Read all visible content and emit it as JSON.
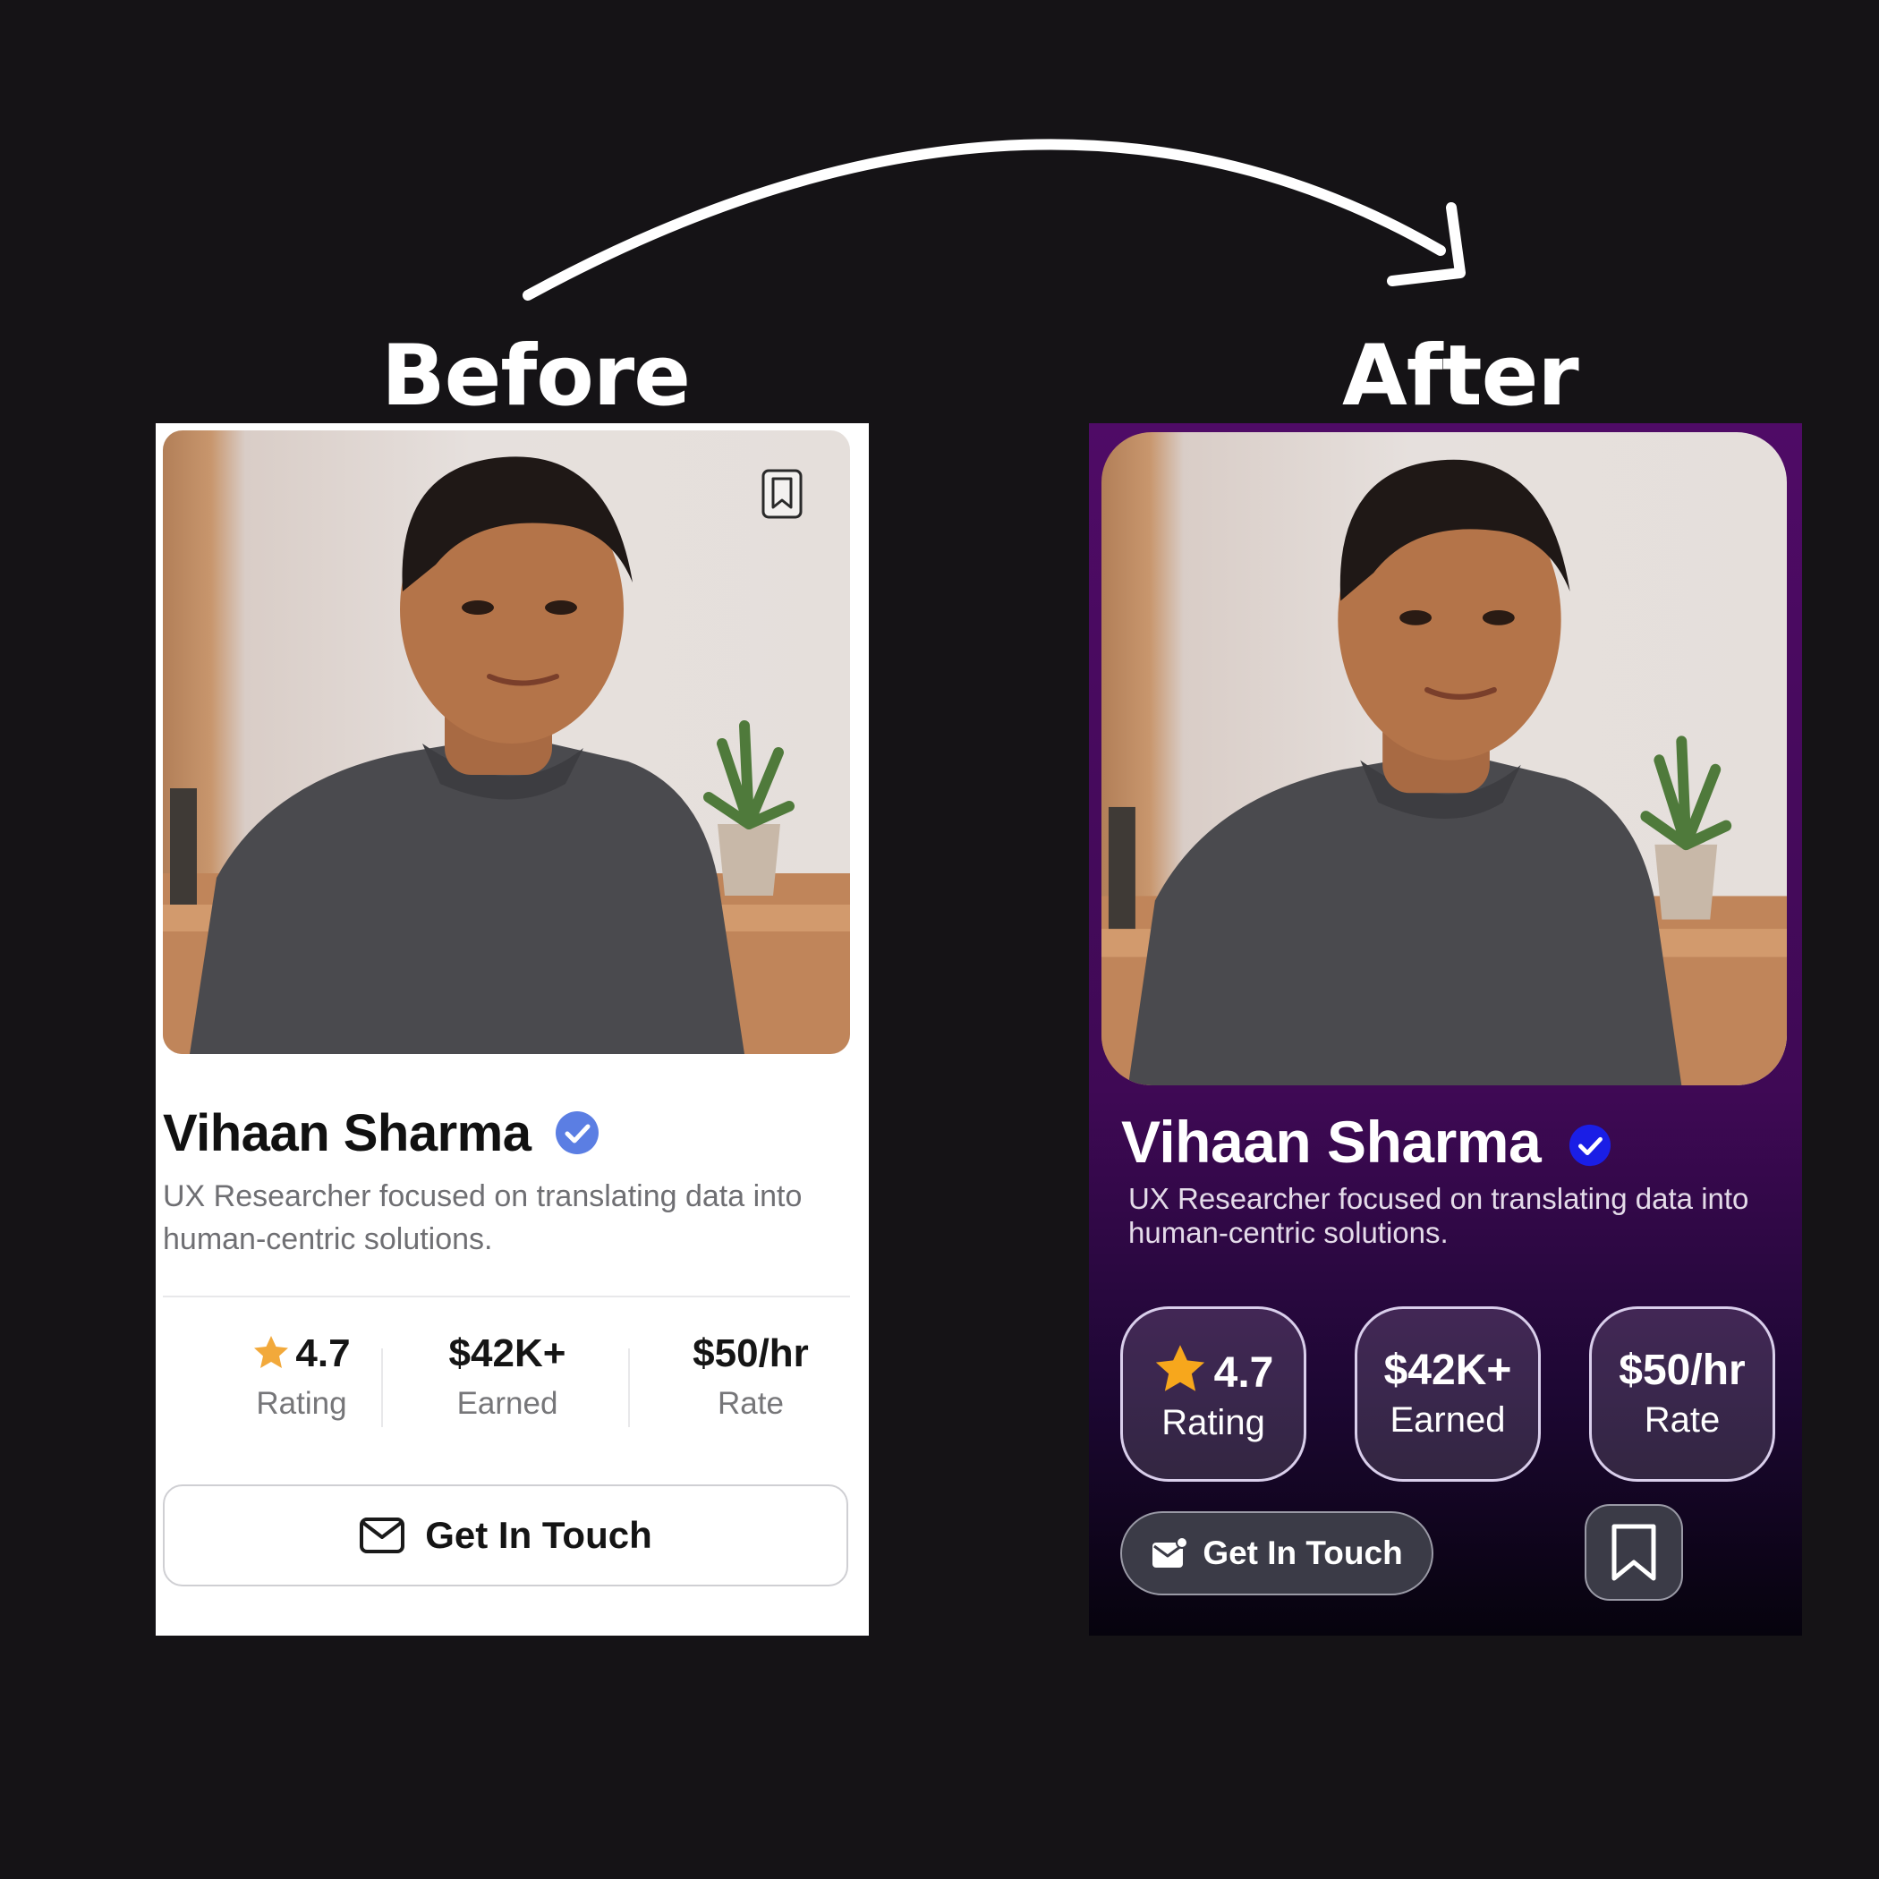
{
  "labels": {
    "before": "Before",
    "after": "After"
  },
  "profile": {
    "name": "Vihaan Sharma",
    "bio": "UX Researcher focused on translating data into human-centric solutions.",
    "stats": [
      {
        "value": "4.7",
        "label": "Rating",
        "icon": "star-icon"
      },
      {
        "value": "$42K+",
        "label": "Earned"
      },
      {
        "value": "$50/hr",
        "label": "Rate"
      }
    ],
    "cta_label": "Get In Touch"
  },
  "colors": {
    "page_bg": "#151316",
    "after_card_top": "#4f0b66",
    "after_card_bottom": "#06030d",
    "before_badge": "#5b7ee3",
    "after_badge": "#1a1ee6",
    "star": "#f2a93b"
  },
  "icons": {
    "before": [
      "bookmark-icon",
      "verified-badge-icon",
      "star-icon",
      "mail-icon"
    ],
    "after": [
      "verified-badge-icon",
      "star-icon",
      "mail-notification-icon",
      "bookmark-icon"
    ]
  }
}
